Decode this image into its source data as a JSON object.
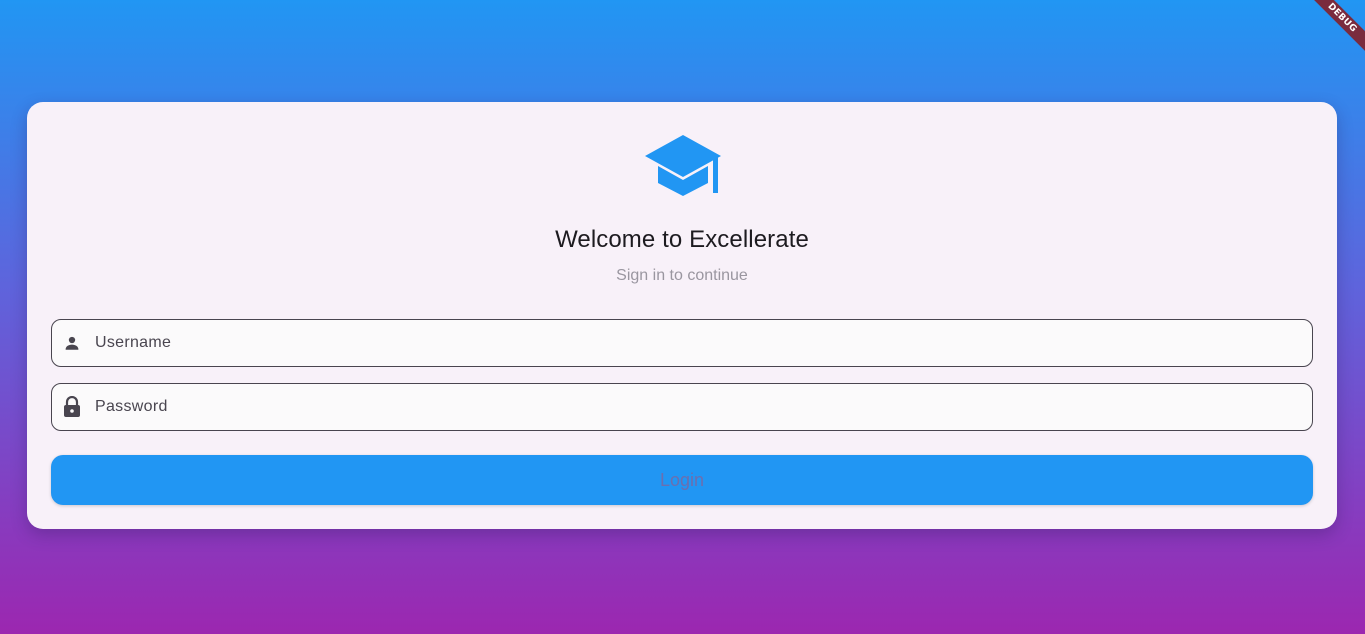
{
  "app": {
    "debug_banner": "DEBUG"
  },
  "login_card": {
    "logo_icon": "graduation-cap-icon",
    "title": "Welcome to Excellerate",
    "subtitle": "Sign in to continue",
    "username": {
      "icon": "person-icon",
      "placeholder": "Username",
      "value": ""
    },
    "password": {
      "icon": "lock-icon",
      "placeholder": "Password",
      "value": ""
    },
    "login_label": "Login"
  },
  "colors": {
    "accent": "#2196f3",
    "background_top": "#2196f3",
    "background_bottom": "#9c27b0",
    "card_background": "#f8f1f9"
  }
}
